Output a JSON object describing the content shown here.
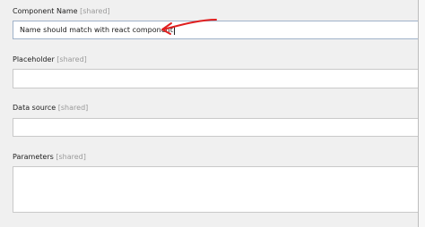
{
  "fields": [
    {
      "label": "Component Name",
      "tag": "[shared]",
      "value": "Name should match with react component"
    },
    {
      "label": "Placeholder",
      "tag": "[shared]",
      "value": ""
    },
    {
      "label": "Data source",
      "tag": "[shared]",
      "value": ""
    },
    {
      "label": "Parameters",
      "tag": "[shared]",
      "value": ""
    }
  ],
  "colors": {
    "annotation_arrow": "#e02020",
    "shared_tag": "#9a9a9a",
    "field_border": "#c9c9c9"
  },
  "icons": {
    "annotation": "red-arrow-annotation-icon"
  }
}
